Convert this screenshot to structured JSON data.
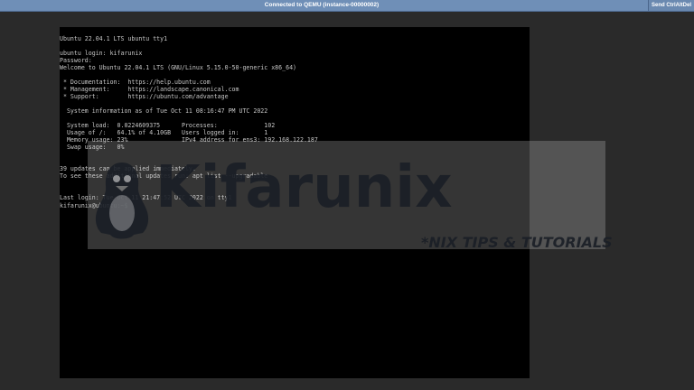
{
  "topbar": {
    "title": "Connected to QEMU (instance-00000002)",
    "send_cad_label": "Send CtrlAltDel"
  },
  "console": {
    "lines": [
      "Ubuntu 22.04.1 LTS ubuntu tty1",
      "",
      "ubuntu login: kifarunix",
      "Password:",
      "Welcome to Ubuntu 22.04.1 LTS (GNU/Linux 5.15.0-50-generic x86_64)",
      "",
      " * Documentation:  https://help.ubuntu.com",
      " * Management:     https://landscape.canonical.com",
      " * Support:        https://ubuntu.com/advantage",
      "",
      "  System information as of Tue Oct 11 08:16:47 PM UTC 2022",
      "",
      "  System load:  0.0224609375      Processes:             102",
      "  Usage of /:   64.1% of 4.10GB   Users logged in:       1",
      "  Memory usage: 23%               IPv4 address for ens3: 192.168.122.187",
      "  Swap usage:   0%",
      "",
      "39 updates can be applied immediately.",
      "To see these additional updates run: apt list --upgradable",
      "",
      "",
      "Last login: Tue Oct 11 21:47:52 UTC 2022 on tty1",
      "kifarunix@ubuntu:~$"
    ]
  },
  "watermark": {
    "brand": "Kifarunix",
    "tagline": "*NIX TIPS & TUTORIALS",
    "icon": "tux-icon"
  },
  "colors": {
    "topbar": "#6f8fb7",
    "console_bg": "#000000",
    "console_text": "#c6c6c6",
    "page_bg": "#2a2a2a"
  }
}
